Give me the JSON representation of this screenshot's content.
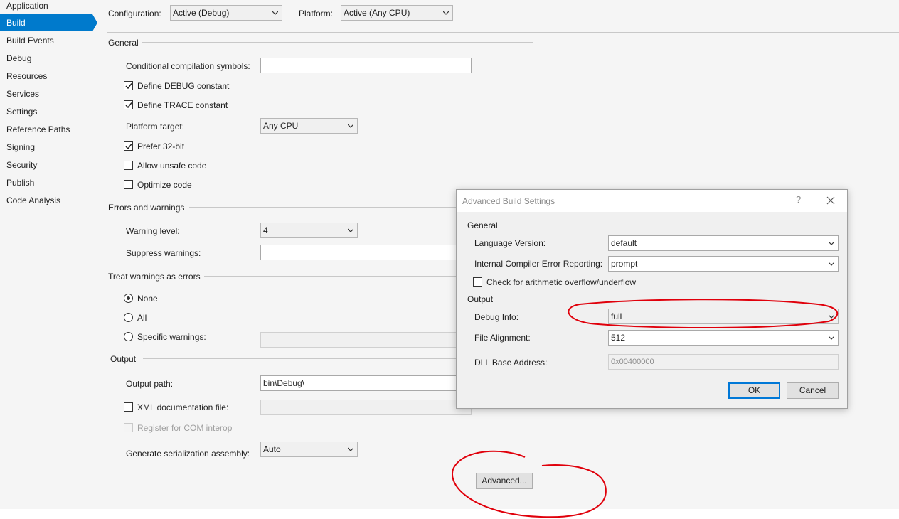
{
  "sidebar": {
    "items": [
      {
        "label": "Application"
      },
      {
        "label": "Build"
      },
      {
        "label": "Build Events"
      },
      {
        "label": "Debug"
      },
      {
        "label": "Resources"
      },
      {
        "label": "Services"
      },
      {
        "label": "Settings"
      },
      {
        "label": "Reference Paths"
      },
      {
        "label": "Signing"
      },
      {
        "label": "Security"
      },
      {
        "label": "Publish"
      },
      {
        "label": "Code Analysis"
      }
    ],
    "active_index": 1
  },
  "toolbar": {
    "configuration_label": "Configuration:",
    "configuration_value": "Active (Debug)",
    "platform_label": "Platform:",
    "platform_value": "Active (Any CPU)"
  },
  "general": {
    "title": "General",
    "cond_symbols_label": "Conditional compilation symbols:",
    "cond_symbols_value": "",
    "define_debug_label": "Define DEBUG constant",
    "define_debug_checked": true,
    "define_trace_label": "Define TRACE constant",
    "define_trace_checked": true,
    "platform_target_label": "Platform target:",
    "platform_target_value": "Any CPU",
    "prefer32_label": "Prefer 32-bit",
    "prefer32_checked": true,
    "unsafe_label": "Allow unsafe code",
    "unsafe_checked": false,
    "optimize_label": "Optimize code",
    "optimize_checked": false
  },
  "errors": {
    "title": "Errors and warnings",
    "warning_level_label": "Warning level:",
    "warning_level_value": "4",
    "suppress_label": "Suppress warnings:",
    "suppress_value": ""
  },
  "treat": {
    "title": "Treat warnings as errors",
    "none_label": "None",
    "all_label": "All",
    "specific_label": "Specific warnings:",
    "selected": "None"
  },
  "output": {
    "title": "Output",
    "path_label": "Output path:",
    "path_value": "bin\\Debug\\",
    "xml_label": "XML documentation file:",
    "xml_checked": false,
    "com_label": "Register for COM interop",
    "serialization_label": "Generate serialization assembly:",
    "serialization_value": "Auto",
    "advanced_label": "Advanced..."
  },
  "dialog": {
    "title": "Advanced Build Settings",
    "help": "?",
    "general_title": "General",
    "lang_label": "Language Version:",
    "lang_value": "default",
    "ice_label": "Internal Compiler Error Reporting:",
    "ice_value": "prompt",
    "overflow_label": "Check for arithmetic overflow/underflow",
    "overflow_checked": false,
    "output_title": "Output",
    "debug_info_label": "Debug Info:",
    "debug_info_value": "full",
    "file_align_label": "File Alignment:",
    "file_align_value": "512",
    "dll_base_label": "DLL Base Address:",
    "dll_base_value": "0x00400000",
    "ok_label": "OK",
    "cancel_label": "Cancel"
  },
  "colors": {
    "accent": "#007acc",
    "annotation": "#e0000b"
  }
}
